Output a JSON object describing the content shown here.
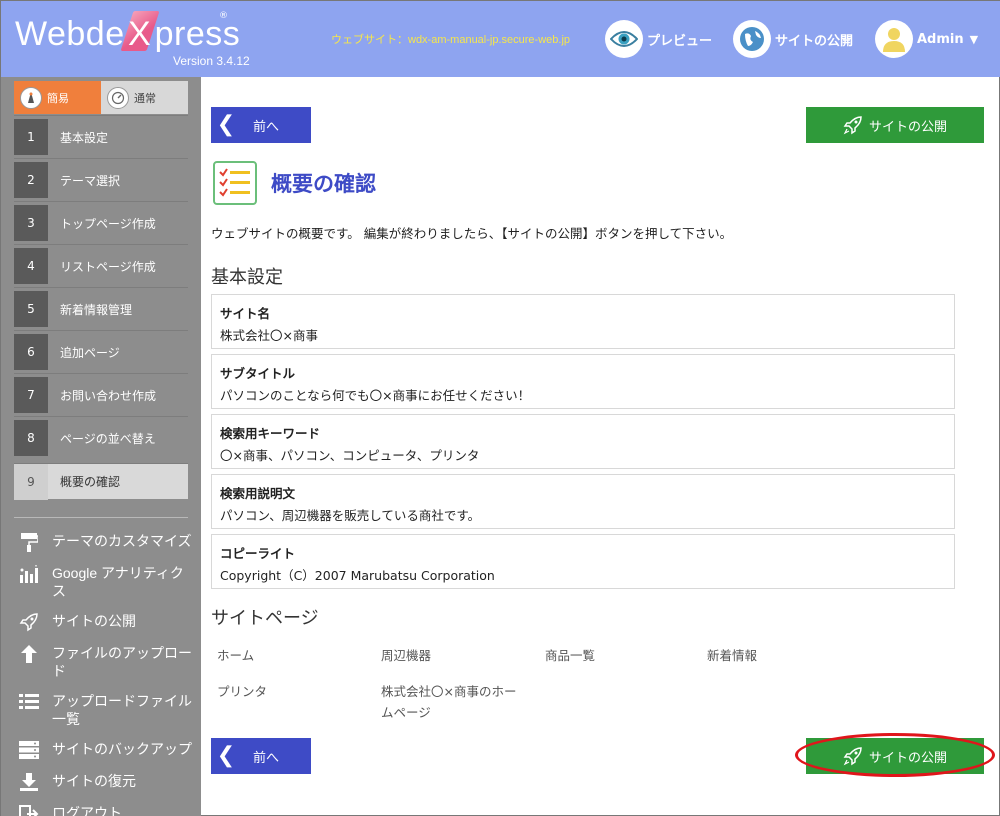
{
  "header": {
    "logo_pre": "Webde",
    "logo_x": "X",
    "logo_post": "press",
    "logo_reg": "®",
    "version": "Version 3.4.12",
    "site_url": "ウェブサイト：wdx-am-manual-jp.secure-web.jp",
    "preview_label": "プレビュー",
    "publish_label": "サイトの公開",
    "admin_label": "Admin",
    "bg_color": "#8ea4f0",
    "url_color": "#f6e64a"
  },
  "sidebar": {
    "modes": [
      {
        "label": "簡易",
        "icon": "wizard-icon"
      },
      {
        "label": "通常",
        "icon": "gauge-icon"
      }
    ],
    "steps": [
      {
        "num": "1",
        "label": "基本設定"
      },
      {
        "num": "2",
        "label": "テーマ選択"
      },
      {
        "num": "3",
        "label": "トップページ作成"
      },
      {
        "num": "4",
        "label": "リストページ作成"
      },
      {
        "num": "5",
        "label": "新着情報管理"
      },
      {
        "num": "6",
        "label": "追加ページ"
      },
      {
        "num": "7",
        "label": "お問い合わせ作成"
      },
      {
        "num": "8",
        "label": "ページの並べ替え"
      },
      {
        "num": "9",
        "label": "概要の確認"
      }
    ],
    "tools": [
      {
        "label": "テーマのカスタマイズ",
        "icon": "paint-roller-icon"
      },
      {
        "label": "Google アナリティクス",
        "icon": "bar-chart-icon"
      },
      {
        "label": "サイトの公開",
        "icon": "rocket-icon"
      },
      {
        "label": "ファイルのアップロード",
        "icon": "upload-icon"
      },
      {
        "label": "アップロードファイル一覧",
        "icon": "list-icon"
      },
      {
        "label": "サイトのバックアップ",
        "icon": "server-icon"
      },
      {
        "label": "サイトの復元",
        "icon": "download-icon"
      },
      {
        "label": "ログアウト",
        "icon": "logout-icon"
      }
    ]
  },
  "main": {
    "prev_label": "前へ",
    "publish_label": "サイトの公開",
    "page_title": "概要の確認",
    "intro": "ウェブサイトの概要です。 編集が終わりましたら、【サイトの公開】ボタンを押して下さい。",
    "basic_title": "基本設定",
    "fields": [
      {
        "label": "サイト名",
        "value": "株式会社〇×商事"
      },
      {
        "label": "サブタイトル",
        "value": "パソコンのことなら何でも〇×商事にお任せください！"
      },
      {
        "label": "検索用キーワード",
        "value": "〇×商事、パソコン、コンピュータ、プリンタ"
      },
      {
        "label": "検索用説明文",
        "value": "パソコン、周辺機器を販売している商社です。"
      },
      {
        "label": "コピーライト",
        "value": "Copyright（C）2007 Marubatsu Corporation"
      }
    ],
    "pages_title": "サイトページ",
    "pages": [
      "ホーム",
      "周辺機器",
      "商品一覧",
      "新着情報",
      "プリンタ",
      "株式会社〇×商事のホームページ"
    ],
    "accent_blue": "#3e4bc6",
    "accent_green": "#2f9a3a",
    "highlight_red": "#e0151b"
  }
}
